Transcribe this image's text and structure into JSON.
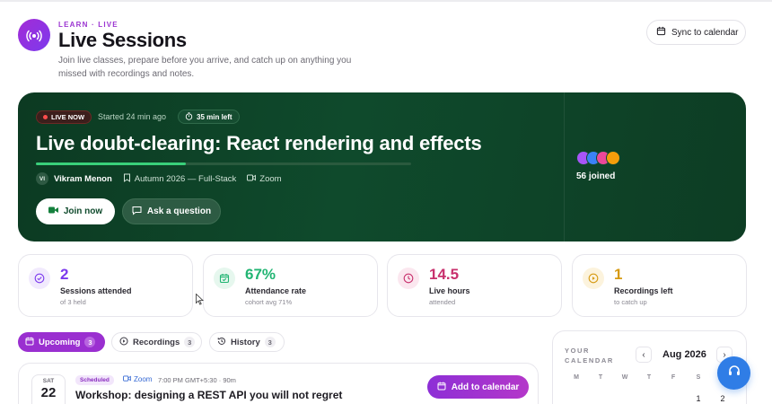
{
  "header": {
    "eyebrow": "LEARN · LIVE",
    "title": "Live Sessions",
    "subtitle": "Join live classes, prepare before you arrive, and catch up on anything you missed with recordings and notes.",
    "sync_label": "Sync to calendar",
    "icon": "broadcast-icon"
  },
  "hero": {
    "badge": "LIVE NOW",
    "started": "Started 24 min ago",
    "time_left": "35 min left",
    "title": "Live doubt-clearing: React rendering and effects",
    "progress": 0.4,
    "instructor_initials": "VI",
    "instructor": "Vikram Menon",
    "cohort": "Autumn 2026 — Full-Stack",
    "platform": "Zoom",
    "join_label": "Join now",
    "ask_label": "Ask a question",
    "joined": "56 joined",
    "attendee_colors": [
      "#a855f7",
      "#3b82f6",
      "#ec4899",
      "#f59e0b"
    ]
  },
  "stats": [
    {
      "value": "2",
      "label": "Sessions attended",
      "sub": "of 3 held",
      "color": "#7c3aed",
      "bg": "#f1eafd",
      "icon": "check-circle-icon"
    },
    {
      "value": "67%",
      "label": "Attendance rate",
      "sub": "cohort avg 71%",
      "color": "#22b573",
      "bg": "#e6f7ee",
      "icon": "calendar-check-icon"
    },
    {
      "value": "14.5",
      "label": "Live hours",
      "sub": "attended",
      "color": "#c8306d",
      "bg": "#fbe7ef",
      "icon": "clock-icon"
    },
    {
      "value": "1",
      "label": "Recordings left",
      "sub": "to catch up",
      "color": "#d69a12",
      "bg": "#fcf3dd",
      "icon": "play-circle-icon"
    }
  ],
  "tabs": [
    {
      "label": "Upcoming",
      "count": "3"
    },
    {
      "label": "Recordings",
      "count": "3"
    },
    {
      "label": "History",
      "count": "3"
    }
  ],
  "session": {
    "dow": "SAT",
    "day": "22",
    "status": "Scheduled",
    "platform": "Zoom",
    "time": "7:00 PM GMT+5:30 · 90m",
    "title": "Workshop: designing a REST API you will not regret",
    "add_label": "Add to calendar"
  },
  "calendar": {
    "caption": "YOUR CALENDAR",
    "month": "Aug 2026",
    "weekdays": [
      "M",
      "T",
      "W",
      "T",
      "F",
      "S",
      "S"
    ],
    "first_row": [
      "",
      "",
      "",
      "",
      "",
      "1",
      "2"
    ]
  }
}
